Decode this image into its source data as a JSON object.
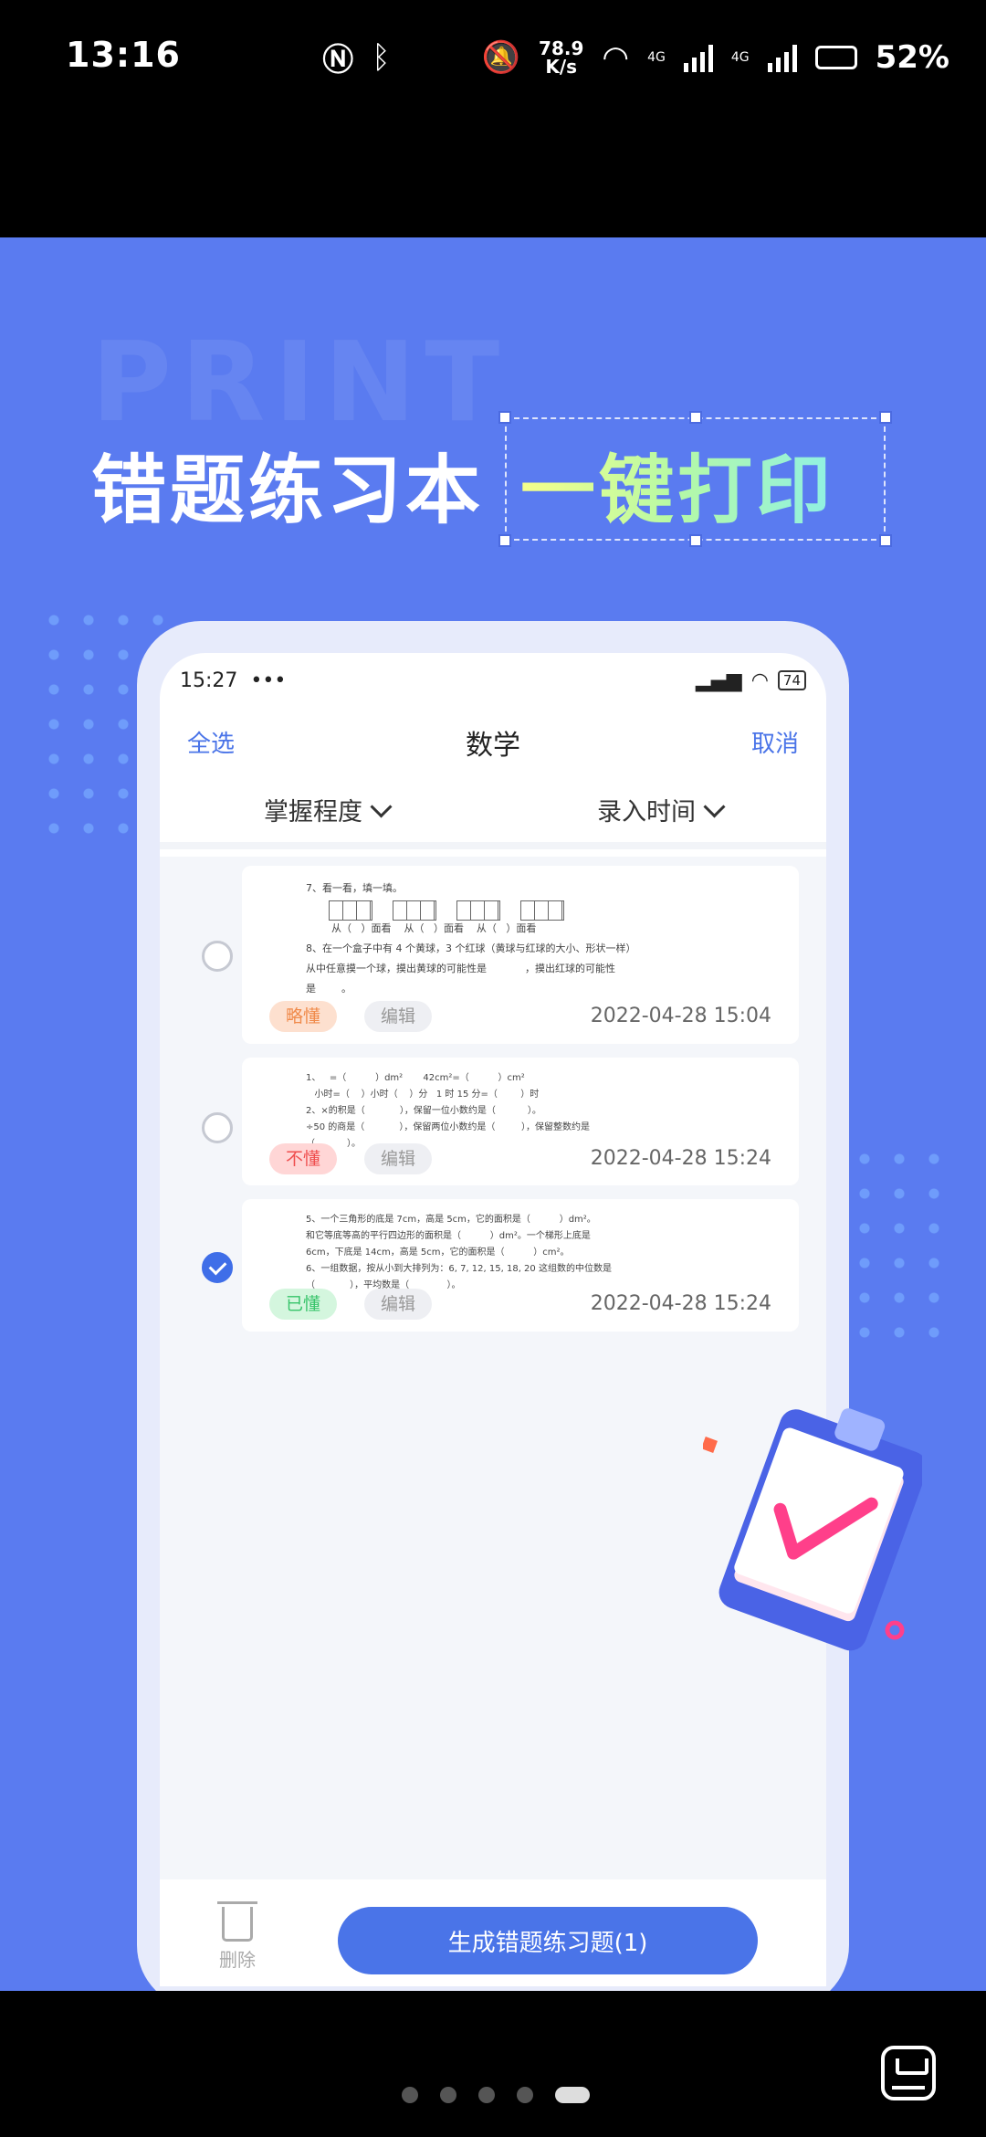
{
  "status_bar": {
    "time": "13:16",
    "speed_top": "78.9",
    "speed_unit": "K/s",
    "network_1": "4G",
    "network_2": "4G",
    "battery": "52%"
  },
  "promo": {
    "bg_word": "PRINT",
    "headline_left": "错题练习本",
    "headline_right": "一键打印"
  },
  "phone": {
    "status_time": "15:27",
    "status_dots": "•••",
    "battery": "74",
    "nav": {
      "select_all": "全选",
      "title": "数学",
      "cancel": "取消"
    },
    "filters": [
      "掌握程度",
      "录入时间"
    ],
    "cards": [
      {
        "checked": false,
        "question_lines": [
          "7、看一看，填一填。",
          "",
          "        从（   ）面看    从（   ）面看    从（   ）面看",
          "8、在一个盒子中有 4 个黄球，3 个红球（黄球与红球的大小、形状一样）",
          "从中任意摸一个球，摸出黄球的可能性是            ，摸出红球的可能性",
          "是        。"
        ],
        "tag": "略懂",
        "tag_type": "vague",
        "edit": "编辑",
        "date": "2022-04-28 15:04"
      },
      {
        "checked": false,
        "question_lines": [
          "1、   =（          ）dm²       42cm²=（          ）cm²",
          "   小时=（    ）小时（    ）分   1 时 15 分=（        ）时",
          "2、×的积是（            ），保留一位小数约是（           ）。",
          "÷50 的商是（            ），保留两位小数约是（         ），保留整数约是",
          "（           ）。"
        ],
        "tag": "不懂",
        "tag_type": "no",
        "edit": "编辑",
        "date": "2022-04-28 15:24"
      },
      {
        "checked": true,
        "question_lines": [
          "5、一个三角形的底是 7cm，高是 5cm，它的面积是（          ）dm²。",
          "和它等底等高的平行四边形的面积是（          ）dm²。一个梯形上底是",
          "6cm，下底是 14cm，高是 5cm，它的面积是（          ）cm²。",
          "6、一组数据，按从小到大排列为：6, 7, 12, 15, 18, 20 这组数的中位数是",
          "（            ），平均数是（             ）。"
        ],
        "tag": "已懂",
        "tag_type": "yes",
        "edit": "编辑",
        "date": "2022-04-28 15:24"
      }
    ],
    "delete_label": "删除",
    "generate_button": "生成错题练习题(1)"
  },
  "nav_pages": {
    "count": 5,
    "active": 5
  },
  "colors": {
    "promo_bg": "#5a7bf0",
    "accent": "#4a74e8"
  }
}
